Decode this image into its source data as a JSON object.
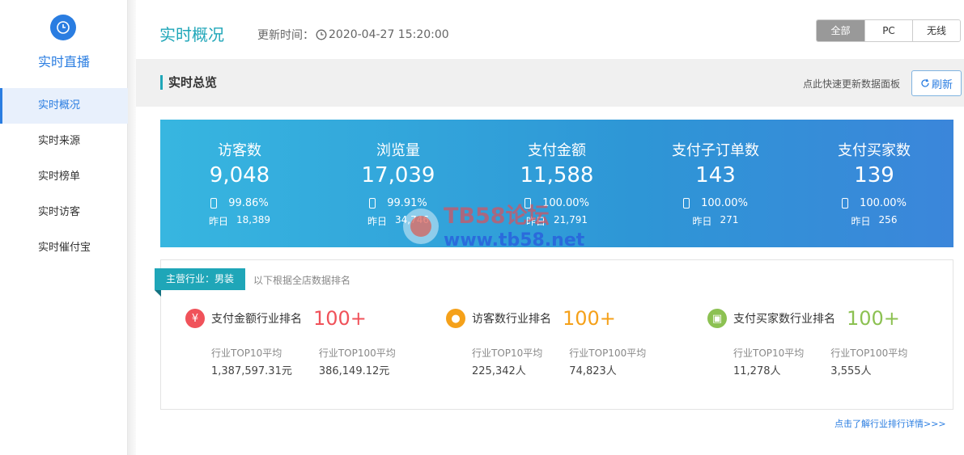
{
  "sidebar": {
    "title": "实时直播",
    "items": [
      {
        "label": "实时概况",
        "active": true
      },
      {
        "label": "实时来源"
      },
      {
        "label": "实时榜单"
      },
      {
        "label": "实时访客"
      },
      {
        "label": "实时催付宝"
      }
    ]
  },
  "header": {
    "title": "实时概况",
    "update_label": "更新时间：",
    "update_time": "2020-04-27 15:20:00",
    "tabs": [
      {
        "label": "全部",
        "active": true
      },
      {
        "label": "PC"
      },
      {
        "label": "无线"
      }
    ]
  },
  "overview": {
    "title": "实时总览",
    "refresh_hint": "点此快速更新数据面板",
    "refresh_label": "刷新"
  },
  "stats": [
    {
      "label": "访客数",
      "value": "9,048",
      "wireless": "99.86%",
      "yesterday_label": "昨日",
      "yesterday": "18,389"
    },
    {
      "label": "浏览量",
      "value": "17,039",
      "wireless": "99.91%",
      "yesterday_label": "昨日",
      "yesterday": "34,746"
    },
    {
      "label": "支付金额",
      "value": "11,588",
      "wireless": "100.00%",
      "yesterday_label": "昨日",
      "yesterday": "21,791"
    },
    {
      "label": "支付子订单数",
      "value": "143",
      "wireless": "100.00%",
      "yesterday_label": "昨日",
      "yesterday": "271"
    },
    {
      "label": "支付买家数",
      "value": "139",
      "wireless": "100.00%",
      "yesterday_label": "昨日",
      "yesterday": "256"
    }
  ],
  "watermark": {
    "line1": "TB58论坛",
    "line2": "www.tb58.net"
  },
  "ranking": {
    "industry_tag": "主营行业：男装",
    "hint": "以下根据全店数据排名",
    "columns": [
      {
        "icon_glyph": "¥",
        "icon_color": "#f0525a",
        "name": "支付金额行业排名",
        "rank": "100+",
        "rank_color": "#f0525a",
        "top10_label": "行业TOP10平均",
        "top10_value": "1,387,597.31元",
        "top100_label": "行业TOP100平均",
        "top100_value": "386,149.12元"
      },
      {
        "icon_glyph": "●",
        "icon_color": "#f5a11a",
        "name": "访客数行业排名",
        "rank": "100+",
        "rank_color": "#f5a11a",
        "top10_label": "行业TOP10平均",
        "top10_value": "225,342人",
        "top100_label": "行业TOP100平均",
        "top100_value": "74,823人"
      },
      {
        "icon_glyph": "▣",
        "icon_color": "#8cc152",
        "name": "支付买家数行业排名",
        "rank": "100+",
        "rank_color": "#8cc152",
        "top10_label": "行业TOP10平均",
        "top10_value": "11,278人",
        "top100_label": "行业TOP100平均",
        "top100_value": "3,555人"
      }
    ],
    "detail_link": "点击了解行业排行详情>>>"
  }
}
